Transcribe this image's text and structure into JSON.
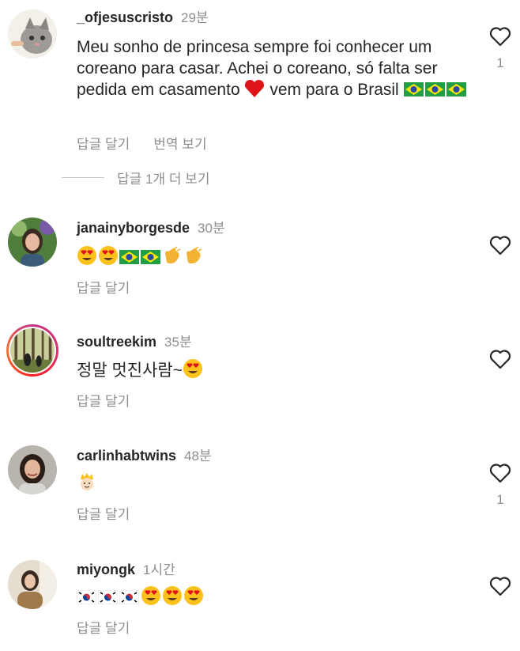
{
  "comments": [
    {
      "username": "_ofjesuscristo",
      "time": "29분",
      "text_part1": "Meu sonho de princesa sempre foi conhecer um coreano para casar. Achei o coreano, só falta ser pedida em casamento",
      "text_part2": "vem para o Brasil",
      "reply_label": "답글 달기",
      "translate_label": "번역 보기",
      "likes": "1",
      "emoji": [
        "heart",
        "flag-brazil",
        "flag-brazil",
        "flag-brazil"
      ]
    },
    {
      "username": "janainyborgesde",
      "time": "30분",
      "reply_label": "답글 달기",
      "emoji": [
        "heart-eyes",
        "heart-eyes",
        "flag-brazil",
        "flag-brazil",
        "clapping",
        "clapping"
      ]
    },
    {
      "username": "soultreekim",
      "time": "35분",
      "text": "정말 멋진사람~",
      "reply_label": "답글 달기",
      "emoji": [
        "heart-eyes"
      ]
    },
    {
      "username": "carlinhabtwins",
      "time": "48분",
      "reply_label": "답글 달기",
      "likes": "1",
      "emoji": [
        "prince"
      ]
    },
    {
      "username": "miyongk",
      "time": "1시간",
      "reply_label": "답글 달기",
      "emoji": [
        "flag-korea",
        "flag-korea",
        "flag-korea",
        "heart-eyes",
        "heart-eyes",
        "heart-eyes"
      ]
    }
  ],
  "view_more_replies": "답글 1개 더 보기",
  "colors": {
    "text": "#262626",
    "secondary": "#8e8e8e",
    "story_ring": "#e1306c"
  }
}
